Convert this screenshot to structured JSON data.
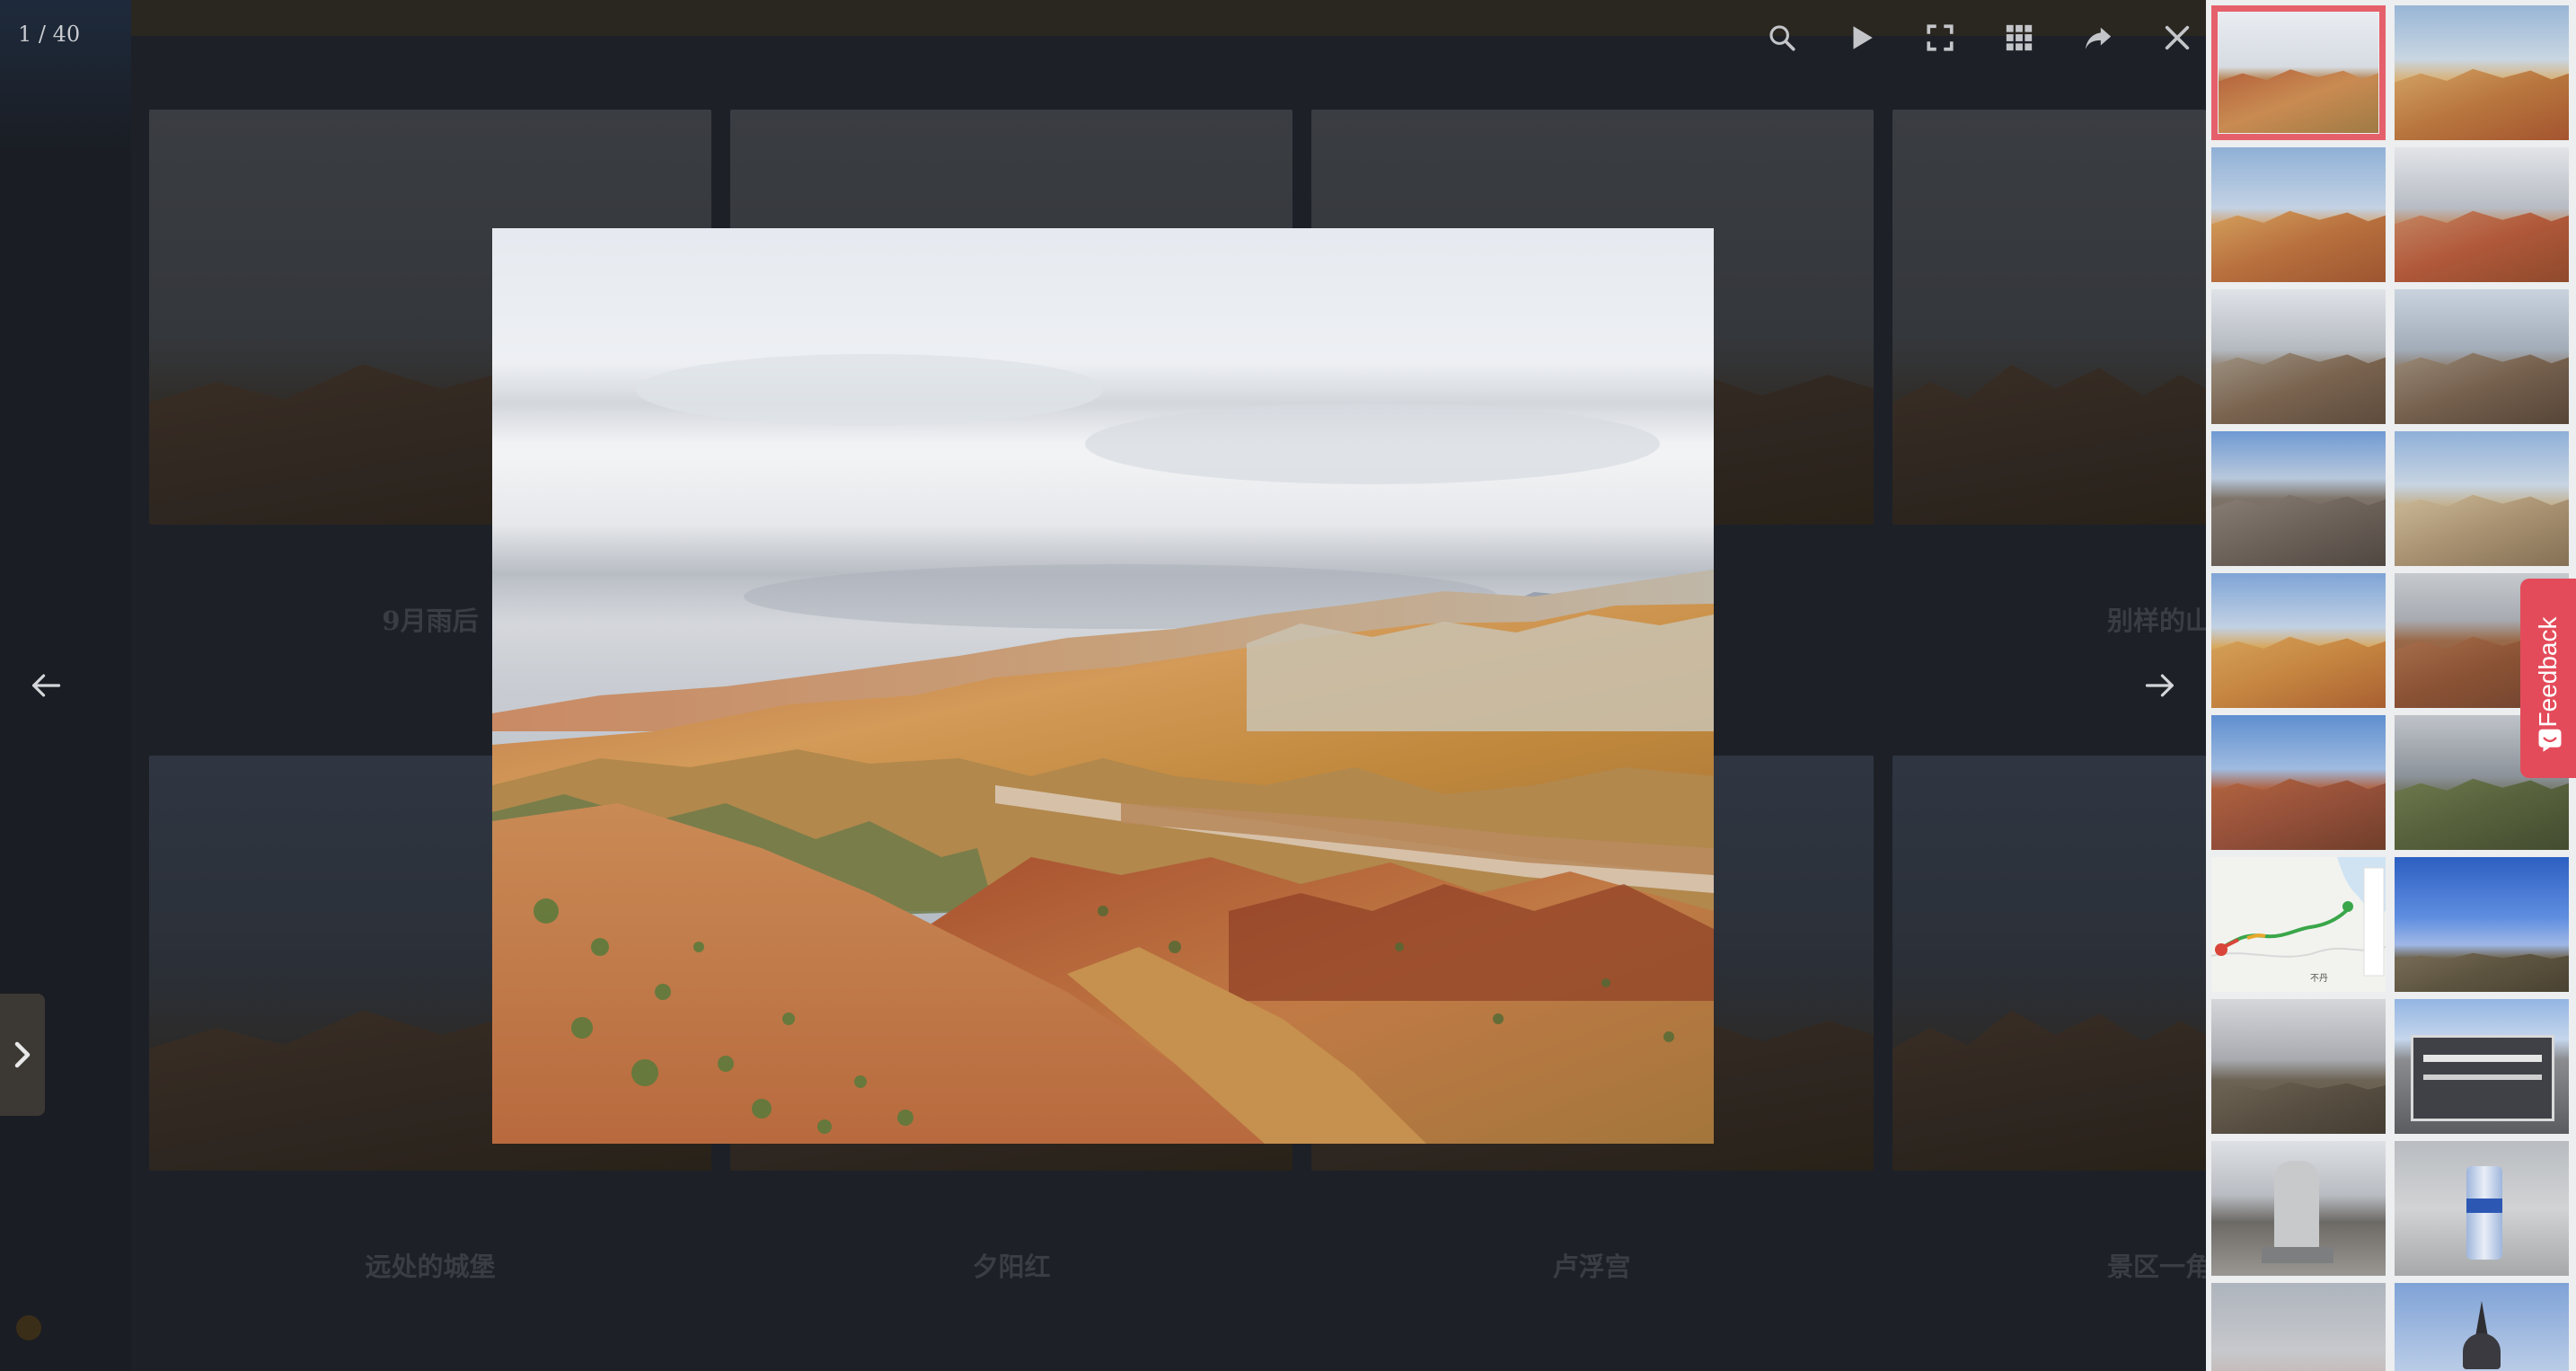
{
  "viewer": {
    "counter": "1 / 40",
    "toolbar": [
      {
        "name": "search-icon",
        "icon": "search"
      },
      {
        "name": "play-icon",
        "icon": "play"
      },
      {
        "name": "fullscreen-icon",
        "icon": "fullscreen"
      },
      {
        "name": "grid-icon",
        "icon": "grid"
      },
      {
        "name": "share-icon",
        "icon": "share"
      },
      {
        "name": "close-icon",
        "icon": "close"
      }
    ],
    "prev_icon": "arrow-left-icon",
    "next_icon": "arrow-right-icon",
    "sidebar_toggle_icon": "chevron-right-icon",
    "accent_color": "#e5606a"
  },
  "background_gallery": {
    "captions_row1": [
      "9月雨后",
      "别样的山"
    ],
    "captions_row2": [
      "远处的城堡",
      "夕阳红",
      "卢浮宫",
      "景区一角"
    ]
  },
  "thumbnails": [
    {
      "kind": "rainbow-mountains",
      "active": true
    },
    {
      "kind": "rainbow-mountains"
    },
    {
      "kind": "rainbow-mountains"
    },
    {
      "kind": "rainbow-mountains-cloudy"
    },
    {
      "kind": "gray-ridges"
    },
    {
      "kind": "gray-ridges"
    },
    {
      "kind": "rock-castle"
    },
    {
      "kind": "sand-hills"
    },
    {
      "kind": "rainbow-mountains"
    },
    {
      "kind": "red-cliffs"
    },
    {
      "kind": "red-cliffs"
    },
    {
      "kind": "green-plain-clouds"
    },
    {
      "kind": "route-map",
      "map_label": "不丹"
    },
    {
      "kind": "blue-sky-plain"
    },
    {
      "kind": "gray-plateau"
    },
    {
      "kind": "stone-sign"
    },
    {
      "kind": "stone-marker"
    },
    {
      "kind": "water-can"
    },
    {
      "kind": "sky-dusk"
    },
    {
      "kind": "stupa"
    }
  ],
  "feedback": {
    "label": "Feedback",
    "color": "#e44b5a"
  }
}
